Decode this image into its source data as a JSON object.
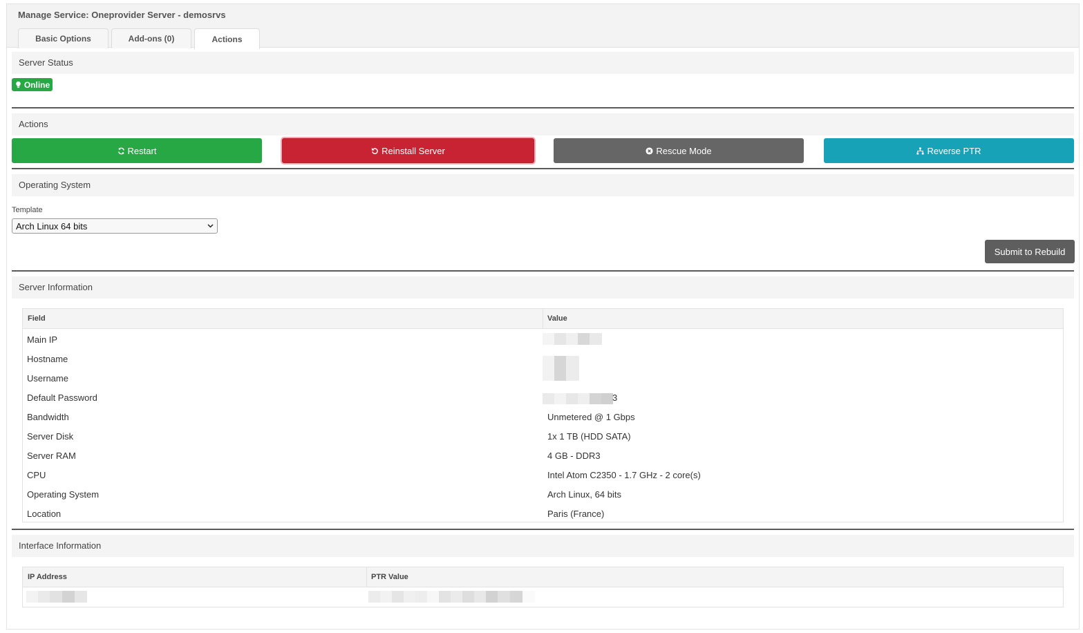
{
  "page": {
    "title": "Manage Service: Oneprovider Server - demosrvs"
  },
  "tabs": [
    {
      "label": "Basic Options"
    },
    {
      "label": "Add-ons (0)"
    },
    {
      "label": "Actions"
    }
  ],
  "server_status": {
    "title": "Server Status",
    "badge": "Online",
    "badge_icon": "lightbulb-icon",
    "badge_color": "#28a745"
  },
  "actions": {
    "title": "Actions",
    "buttons": [
      {
        "label": "Restart",
        "icon": "refresh-icon",
        "color": "#28a745"
      },
      {
        "label": "Reinstall Server",
        "icon": "undo-icon",
        "color": "#c82333"
      },
      {
        "label": "Rescue Mode",
        "icon": "times-circle-icon",
        "color": "#666666"
      },
      {
        "label": "Reverse PTR",
        "icon": "sitemap-icon",
        "color": "#17a2b8"
      }
    ]
  },
  "os": {
    "title": "Operating System",
    "template_label": "Template",
    "template_value": "Arch Linux 64 bits",
    "submit_label": "Submit to Rebuild"
  },
  "server_info": {
    "title": "Server Information",
    "col_field": "Field",
    "col_value": "Value",
    "rows": [
      {
        "field": "Main IP",
        "value": ""
      },
      {
        "field": "Hostname",
        "value": ""
      },
      {
        "field": "Username",
        "value": ""
      },
      {
        "field": "Default Password",
        "value": "3"
      },
      {
        "field": "Bandwidth",
        "value": "Unmetered @ 1 Gbps"
      },
      {
        "field": "Server Disk",
        "value": "1x 1 TB (HDD SATA)"
      },
      {
        "field": "Server RAM",
        "value": "4 GB - DDR3"
      },
      {
        "field": "CPU",
        "value": "Intel Atom C2350 - 1.7 GHz - 2 core(s)"
      },
      {
        "field": "Operating System",
        "value": "Arch Linux, 64 bits"
      },
      {
        "field": "Location",
        "value": "Paris (France)"
      }
    ]
  },
  "interface_info": {
    "title": "Interface Information",
    "col_ip": "IP Address",
    "col_ptr": "PTR Value"
  }
}
